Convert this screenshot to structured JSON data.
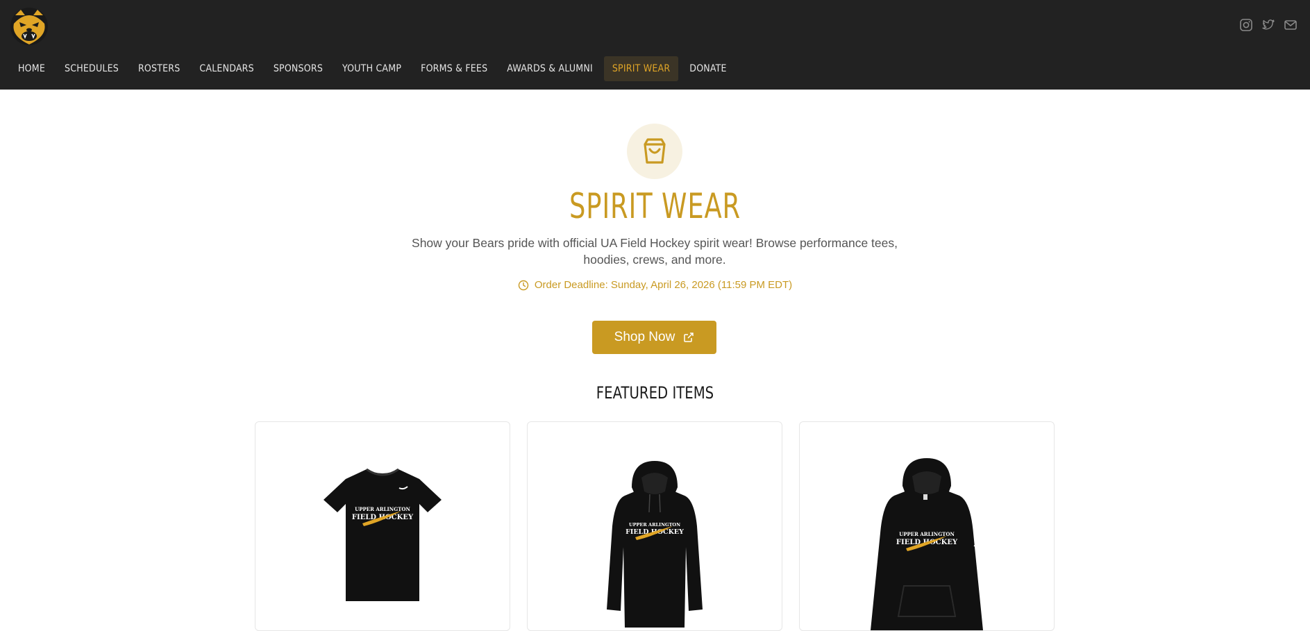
{
  "nav": {
    "items": [
      {
        "label": "HOME",
        "active": false
      },
      {
        "label": "SCHEDULES",
        "active": false
      },
      {
        "label": "ROSTERS",
        "active": false
      },
      {
        "label": "CALENDARS",
        "active": false
      },
      {
        "label": "SPONSORS",
        "active": false
      },
      {
        "label": "YOUTH CAMP",
        "active": false
      },
      {
        "label": "FORMS & FEES",
        "active": false
      },
      {
        "label": "AWARDS & ALUMNI",
        "active": false
      },
      {
        "label": "SPIRIT WEAR",
        "active": true
      },
      {
        "label": "DONATE",
        "active": false
      }
    ]
  },
  "social": {
    "icons": [
      "instagram-icon",
      "twitter-icon",
      "mail-icon"
    ]
  },
  "hero": {
    "icon": "shopping-bag-icon",
    "title": "SPIRIT WEAR",
    "description": "Show your Bears pride with official UA Field Hockey spirit wear! Browse performance tees, hoodies, crews, and more.",
    "deadline": "Order Deadline: Sunday, April 26, 2026 (11:59 PM EDT)",
    "shop_label": "Shop Now"
  },
  "featured": {
    "heading": "FEATURED ITEMS",
    "items": [
      {
        "kind": "tee",
        "print_line1": "UPPER ARLINGTON",
        "print_line2": "FIELD HOCKEY"
      },
      {
        "kind": "hoodie",
        "print_line1": "UPPER ARLINGTON",
        "print_line2": "FIELD HOCKEY"
      },
      {
        "kind": "hoodie-pocket",
        "print_line1": "UPPER ARLINGTON",
        "print_line2": "FIELD HOCKEY"
      }
    ]
  },
  "colors": {
    "accent": "#c99a22",
    "header_bg": "#222222",
    "nav_active_bg": "#3b3426",
    "nav_active_text": "#e0a526"
  }
}
